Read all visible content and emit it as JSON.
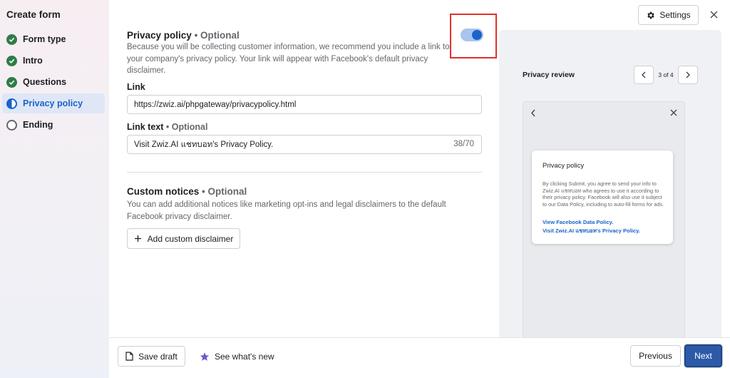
{
  "sidebar": {
    "title": "Create form",
    "steps": [
      {
        "label": "Form type",
        "state": "done"
      },
      {
        "label": "Intro",
        "state": "done"
      },
      {
        "label": "Questions",
        "state": "done"
      },
      {
        "label": "Privacy policy",
        "state": "current"
      },
      {
        "label": "Ending",
        "state": "pending"
      }
    ]
  },
  "header": {
    "settings_label": "Settings"
  },
  "privacy": {
    "title": "Privacy policy",
    "optional": "• Optional",
    "description": "Because you will be collecting customer information, we recommend you include a link to your company's privacy policy. Your link will appear with Facebook's default privacy disclaimer.",
    "toggle_on": true,
    "link_label": "Link",
    "link_value": "https://zwiz.ai/phpgateway/privacypolicy.html",
    "link_text_label": "Link text",
    "link_text_optional": "• Optional",
    "link_text_value": "Visit Zwiz.AI แชทบอท's Privacy Policy.",
    "char_count": "38/70"
  },
  "notices": {
    "title": "Custom notices",
    "optional": "• Optional",
    "description": "You can add additional notices like marketing opt-ins and legal disclaimers to the default Facebook privacy disclaimer.",
    "add_button": "Add custom disclaimer"
  },
  "preview": {
    "title": "Privacy review",
    "page_indicator": "3 of 4",
    "card_title": "Privacy policy",
    "card_text": "By clicking Submit, you agree to send your info to Zwiz.AI แชทบอท who agrees to use it according to their privacy policy. Facebook will also use it subject to our Data Policy, including to auto-fill forms for ads.",
    "link_1": "View Facebook Data Policy.",
    "link_2": "Visit Zwiz.AI แชทบอท's Privacy Policy."
  },
  "footer": {
    "save_draft": "Save draft",
    "whats_new": "See what's new",
    "previous": "Previous",
    "next": "Next"
  },
  "colors": {
    "accent": "#1b63c9",
    "next_button": "#2d5aa8",
    "done_check": "#2e7d46",
    "highlight": "#e0312d"
  }
}
